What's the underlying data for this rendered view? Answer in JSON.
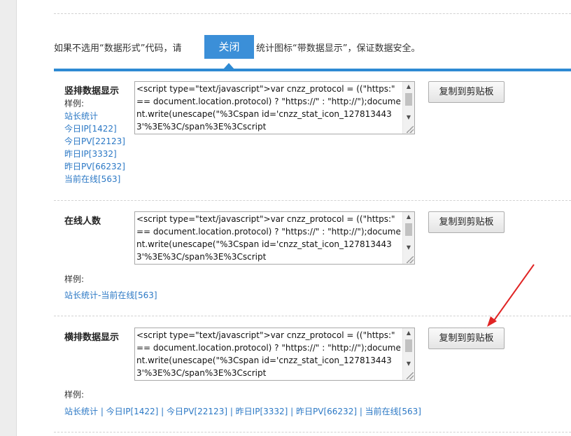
{
  "notice": {
    "text_before": "如果不选用“数据形式”代码，请",
    "close_button": "关闭",
    "text_after": "统计图标“带数据显示”，保证数据安全。"
  },
  "code_snippet": "<script type=\"text/javascript\">var cnzz_protocol = ((\"https:\" == document.location.protocol) ? \"https://\" : \"http://\");document.write(unescape(\"%3Cspan id='cnzz_stat_icon_1278134433'%3E%3C/span%3E%3Cscript",
  "copy_label": "复制到剪贴板",
  "sample_label": "样例:",
  "sections": [
    {
      "title": "竖排数据显示",
      "links": [
        "站长统计",
        "今日IP[1422]",
        "今日PV[22123]",
        "昨日IP[3332]",
        "昨日PV[66232]",
        "当前在线[563]"
      ]
    },
    {
      "title": "在线人数",
      "link": "站长统计-当前在线[563]"
    },
    {
      "title": "横排数据显示",
      "link": "站长统计 | 今日IP[1422] | 今日PV[22123] | 昨日IP[3332] | 昨日PV[66232] | 当前在线[563]"
    }
  ],
  "colors": {
    "accent": "#2e8ad3",
    "close_button": "#3b8fd8",
    "link": "#2b78c5",
    "annotation_arrow": "#e02424"
  }
}
